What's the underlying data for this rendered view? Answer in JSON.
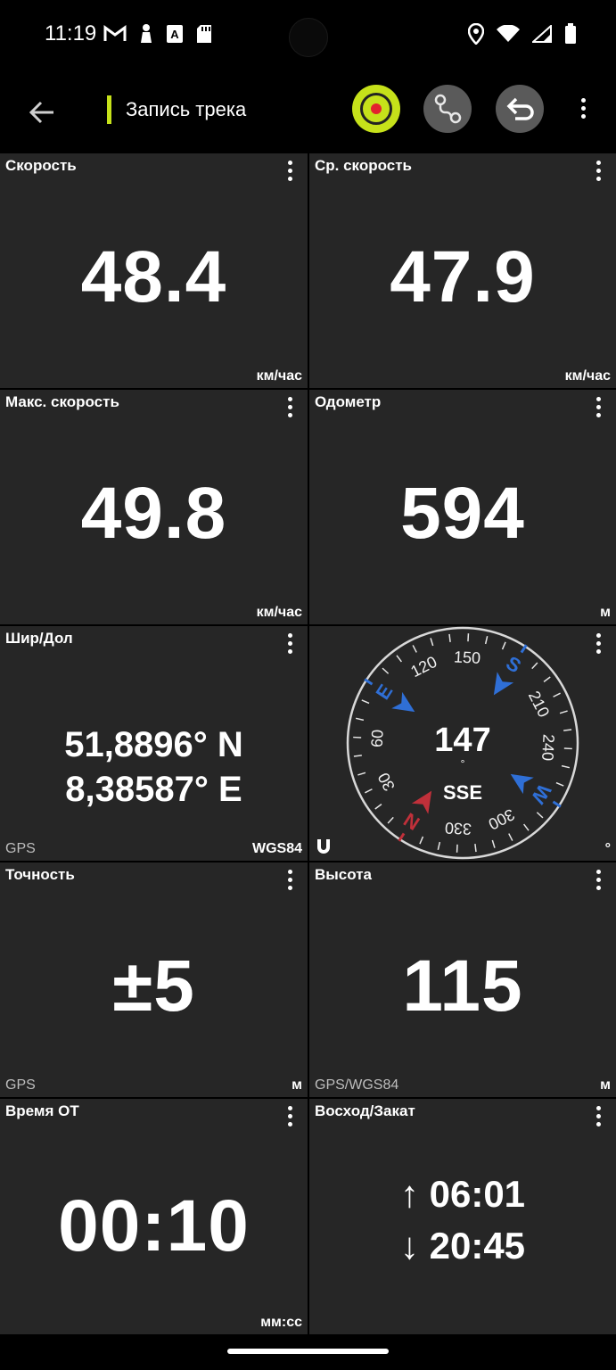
{
  "status_bar": {
    "time": "11:19",
    "left_icons": [
      "gmail-icon",
      "chess-pawn-icon",
      "font-a-icon",
      "sd-card-icon"
    ],
    "right_icons": [
      "location-pin-icon",
      "wifi-icon",
      "signal-icon",
      "battery-icon"
    ]
  },
  "toolbar": {
    "title": "Запись трека",
    "accent_color": "#c6e11a",
    "record_color": "#e3222e"
  },
  "tiles": {
    "speed": {
      "label": "Скорость",
      "value": "48.4",
      "unit": "км/час"
    },
    "avg_speed": {
      "label": "Ср. скорость",
      "value": "47.9",
      "unit": "км/час"
    },
    "max_speed": {
      "label": "Макс. скорость",
      "value": "49.8",
      "unit": "км/час"
    },
    "odometer": {
      "label": "Одометр",
      "value": "594",
      "unit": "м"
    },
    "latlon": {
      "label": "Шир/Дол",
      "lat": "51,8896° N",
      "lon": "8,38587° E",
      "source": "GPS",
      "datum": "WGS84"
    },
    "compass": {
      "heading": "147",
      "degree_symbol": "°",
      "direction": "SSE",
      "unit": "°",
      "tick_labels": [
        "120",
        "150",
        "210",
        "240",
        "300",
        "330",
        "30",
        "60"
      ],
      "cardinals": [
        "S",
        "E",
        "W",
        "N"
      ],
      "cardinal_color": "#2f6fd6",
      "north_color": "#c0303a"
    },
    "accuracy": {
      "label": "Точность",
      "value": "±5",
      "source": "GPS",
      "unit": "м"
    },
    "altitude": {
      "label": "Высота",
      "value": "115",
      "source": "GPS/WGS84",
      "unit": "м"
    },
    "time": {
      "label": "Время ОТ",
      "value": "00:10",
      "unit": "мм:сс"
    },
    "sun": {
      "label": "Восход/Закат",
      "sunrise": "↑ 06:01",
      "sunset": "↓ 20:45"
    }
  }
}
